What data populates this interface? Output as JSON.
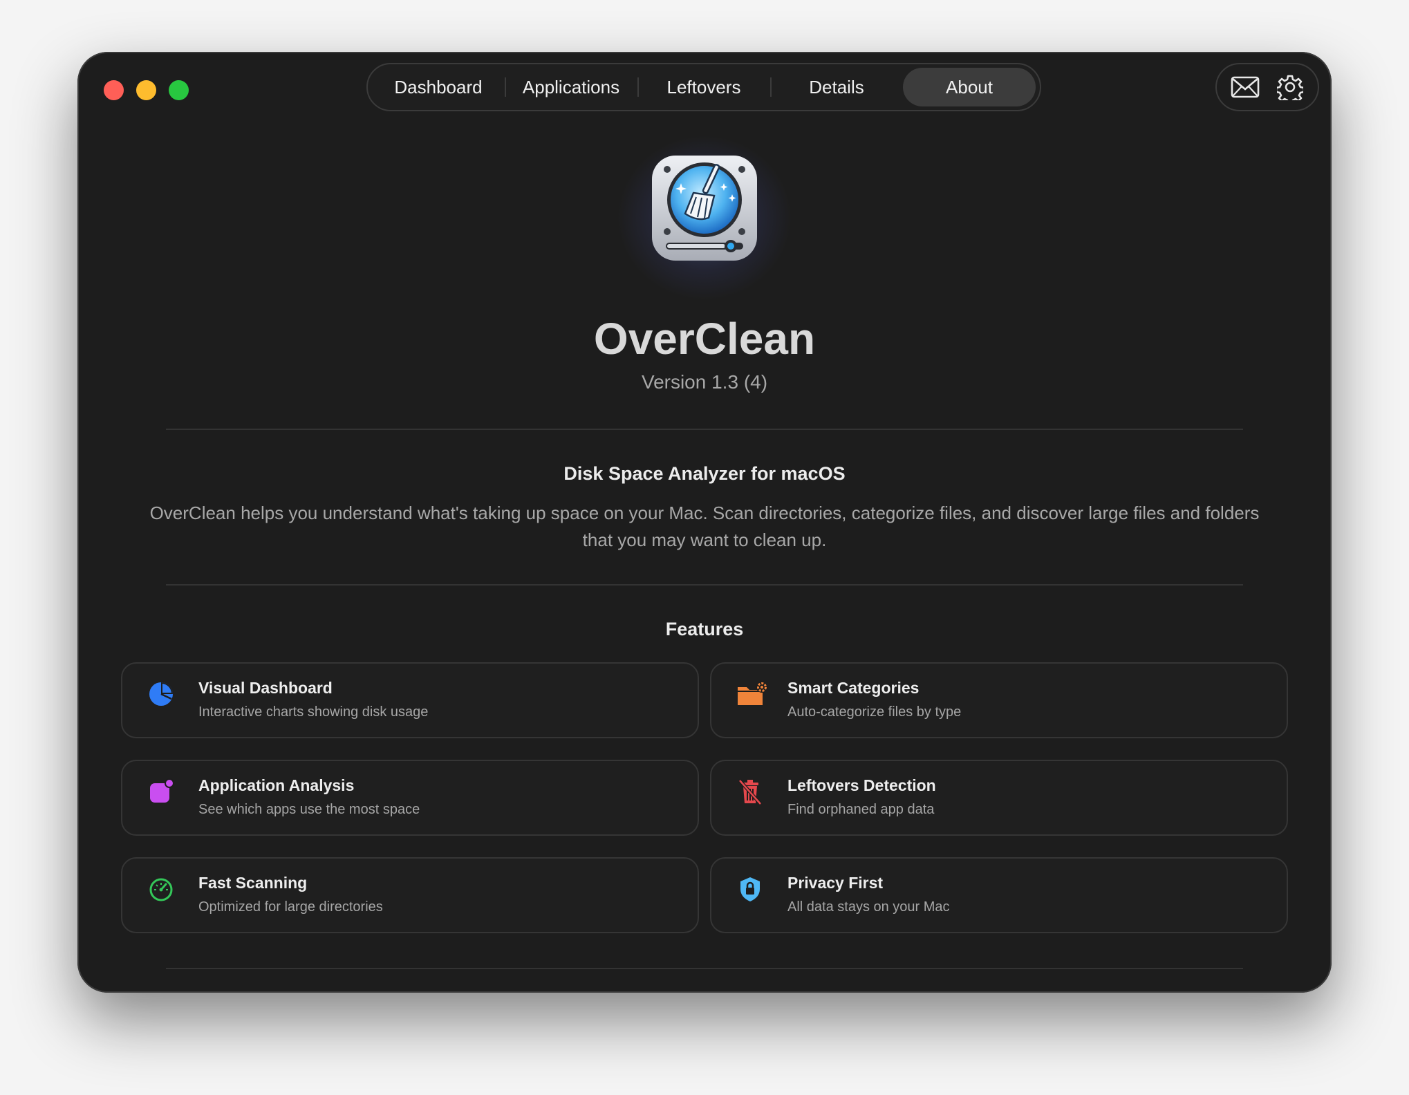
{
  "tabs": [
    {
      "label": "Dashboard"
    },
    {
      "label": "Applications"
    },
    {
      "label": "Leftovers"
    },
    {
      "label": "Details"
    },
    {
      "label": "About"
    }
  ],
  "active_tab": "About",
  "toolbar": {
    "icons": [
      "mail-icon",
      "gear-icon"
    ]
  },
  "about": {
    "app_name": "OverClean",
    "version": "Version 1.3 (4)",
    "subtitle": "Disk Space Analyzer for macOS",
    "description": "OverClean helps you understand what's taking up space on your Mac. Scan directories, categorize files, and discover large files and folders that you may want to clean up.",
    "features_title": "Features"
  },
  "features": [
    {
      "title": "Visual Dashboard",
      "desc": "Interactive charts showing disk usage",
      "icon": "pie-chart-icon",
      "color": "#2f7cf6"
    },
    {
      "title": "Smart Categories",
      "desc": "Auto-categorize files by type",
      "icon": "folder-gear-icon",
      "color": "#f0843a"
    },
    {
      "title": "Application Analysis",
      "desc": "See which apps use the most space",
      "icon": "app-badge-icon",
      "color": "#c94ef0"
    },
    {
      "title": "Leftovers Detection",
      "desc": "Find orphaned app data",
      "icon": "trash-slash-icon",
      "color": "#e5484d"
    },
    {
      "title": "Fast Scanning",
      "desc": "Optimized for large directories",
      "icon": "gauge-icon",
      "color": "#34c759"
    },
    {
      "title": "Privacy First",
      "desc": "All data stays on your Mac",
      "icon": "lock-shield-icon",
      "color": "#4fb8f5"
    }
  ]
}
